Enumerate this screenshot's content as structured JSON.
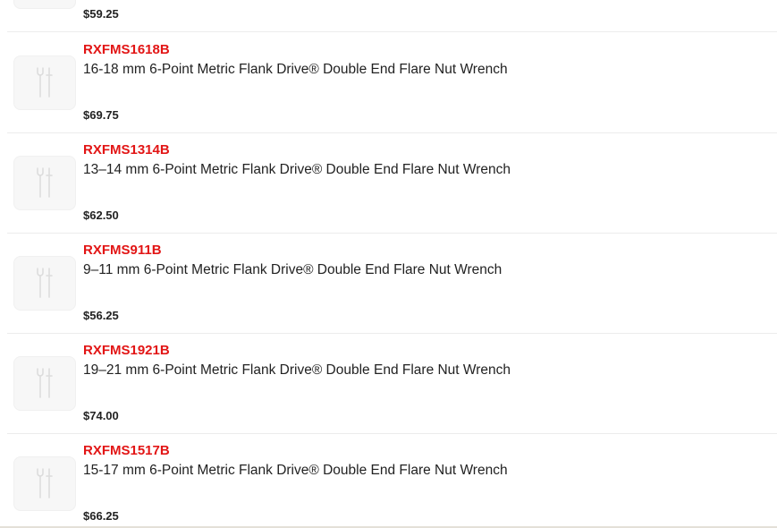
{
  "products": [
    {
      "sku": "",
      "title": "",
      "price": "$59.25",
      "icon": "wrench-screwdriver-icon"
    },
    {
      "sku": "RXFMS1618B",
      "title": "16-18 mm 6-Point Metric Flank Drive® Double End Flare Nut Wrench",
      "price": "$69.75",
      "icon": "wrench-screwdriver-icon"
    },
    {
      "sku": "RXFMS1314B",
      "title": "13–14 mm 6-Point Metric Flank Drive® Double End Flare Nut Wrench",
      "price": "$62.50",
      "icon": "wrench-screwdriver-icon"
    },
    {
      "sku": "RXFMS911B",
      "title": "9–11 mm 6-Point Metric Flank Drive® Double End Flare Nut Wrench",
      "price": "$56.25",
      "icon": "wrench-screwdriver-icon"
    },
    {
      "sku": "RXFMS1921B",
      "title": "19–21 mm 6-Point Metric Flank Drive® Double End Flare Nut Wrench",
      "price": "$74.00",
      "icon": "wrench-screwdriver-icon"
    },
    {
      "sku": "RXFMS1517B",
      "title": "15-17 mm 6-Point Metric Flank Drive® Double End Flare Nut Wrench",
      "price": "$66.25",
      "icon": "wrench-screwdriver-icon"
    }
  ],
  "colors": {
    "sku": "#e21515",
    "text": "#222222",
    "divider": "#ececec",
    "thumb_bg": "#f7f7f7"
  }
}
